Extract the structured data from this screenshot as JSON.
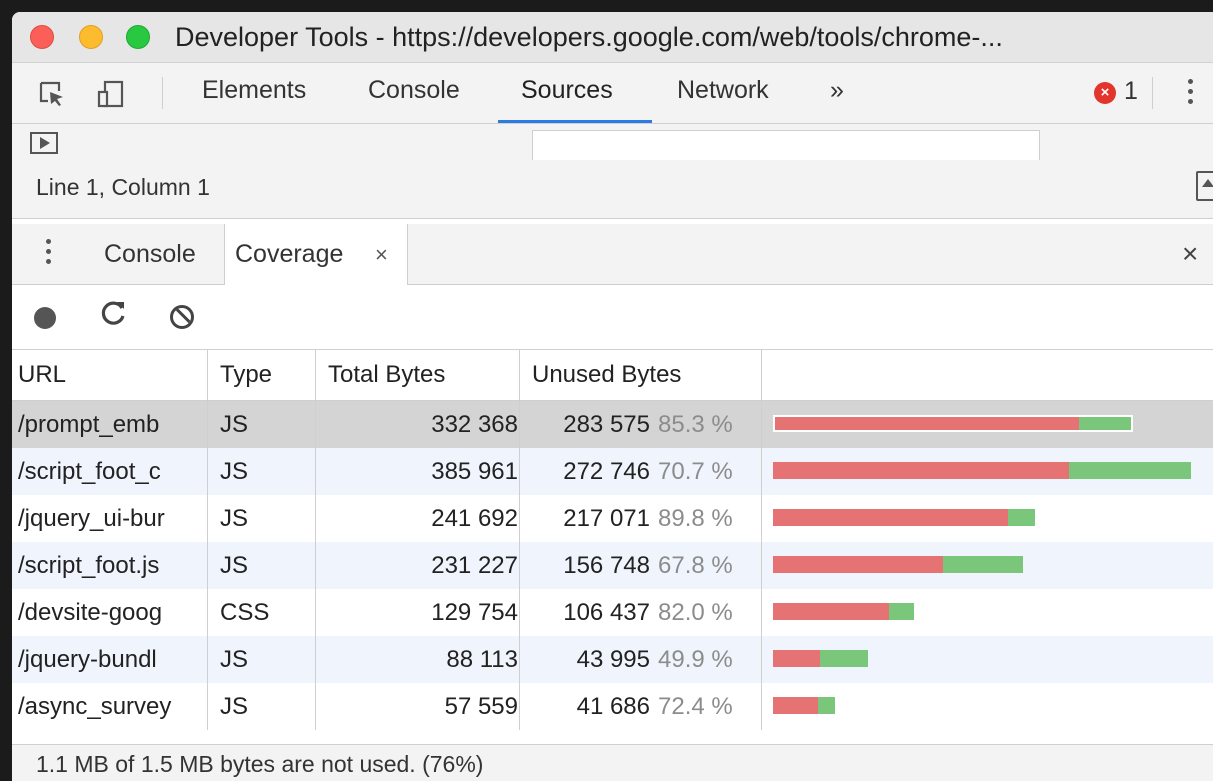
{
  "window": {
    "title": "Developer Tools - https://developers.google.com/web/tools/chrome-..."
  },
  "main_tabs": [
    {
      "label": "Elements"
    },
    {
      "label": "Console"
    },
    {
      "label": "Sources"
    },
    {
      "label": "Network"
    },
    {
      "label": "»"
    }
  ],
  "errors": {
    "count": "1"
  },
  "status": {
    "cursor": "Line 1, Column 1"
  },
  "drawer": {
    "tabs": [
      {
        "label": "Console"
      },
      {
        "label": "Coverage"
      }
    ],
    "close_glyph": "×",
    "tab_close_glyph": "×"
  },
  "coverage": {
    "columns": {
      "url": "URL",
      "type": "Type",
      "total": "Total Bytes",
      "unused": "Unused Bytes"
    },
    "rows": [
      {
        "url": "/prompt_emb",
        "type": "JS",
        "total": "332 368",
        "unused": "283 575",
        "pct": "85.3 %",
        "total_bytes": 332368,
        "unused_fraction": 0.853
      },
      {
        "url": "/script_foot_c",
        "type": "JS",
        "total": "385 961",
        "unused": "272 746",
        "pct": "70.7 %",
        "total_bytes": 385961,
        "unused_fraction": 0.707
      },
      {
        "url": "/jquery_ui-bur",
        "type": "JS",
        "total": "241 692",
        "unused": "217 071",
        "pct": "89.8 %",
        "total_bytes": 241692,
        "unused_fraction": 0.898
      },
      {
        "url": "/script_foot.js",
        "type": "JS",
        "total": "231 227",
        "unused": "156 748",
        "pct": "67.8 %",
        "total_bytes": 231227,
        "unused_fraction": 0.678
      },
      {
        "url": "/devsite-goog",
        "type": "CSS",
        "total": "129 754",
        "unused": "106 437",
        "pct": "82.0 %",
        "total_bytes": 129754,
        "unused_fraction": 0.82
      },
      {
        "url": "/jquery-bundl",
        "type": "JS",
        "total": "88 113",
        "unused": "43 995",
        "pct": "49.9 %",
        "total_bytes": 88113,
        "unused_fraction": 0.499
      },
      {
        "url": "/async_survey",
        "type": "JS",
        "total": "57 559",
        "unused": "41 686",
        "pct": "72.4 %",
        "total_bytes": 57559,
        "unused_fraction": 0.724
      }
    ],
    "footer": "1.1 MB of 1.5 MB bytes are not used. (76%)"
  },
  "icons": {
    "inspect": "inspect-element-icon",
    "device": "device-toolbar-icon",
    "record": "record-icon",
    "reload": "reload-icon",
    "clear": "clear-icon"
  },
  "colors": {
    "unused_bar": "#e57373",
    "used_bar": "#7ac67a",
    "active_tab_underline": "#2a7be4",
    "error_badge": "#e2362c"
  }
}
